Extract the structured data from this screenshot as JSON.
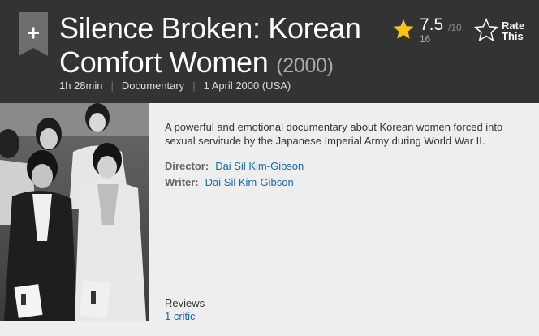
{
  "movie": {
    "title": "Silence Broken: Korean Comfort Women",
    "year": "(2000)",
    "runtime": "1h 28min",
    "genre": "Documentary",
    "release_date": "1 April 2000 (USA)"
  },
  "rating": {
    "value": "7.5",
    "max": "/10",
    "count": "16",
    "star_icon": "star-icon",
    "star_color": "#f5c518"
  },
  "rate_this": {
    "line1": "Rate",
    "line2": "This"
  },
  "watchlist": {
    "icon": "plus-icon"
  },
  "summary": "A powerful and emotional documentary about Korean women forced into sexual servitude by the Japanese Imperial Army during World War II.",
  "credits": {
    "director_label": "Director:",
    "director": "Dai Sil Kim-Gibson",
    "writer_label": "Writer:",
    "writer": "Dai Sil Kim-Gibson"
  },
  "reviews": {
    "label": "Reviews",
    "critic_link": "1 critic"
  },
  "colors": {
    "header_bg": "#333333",
    "link": "#136cb2",
    "page_bg": "#eeeeee"
  }
}
